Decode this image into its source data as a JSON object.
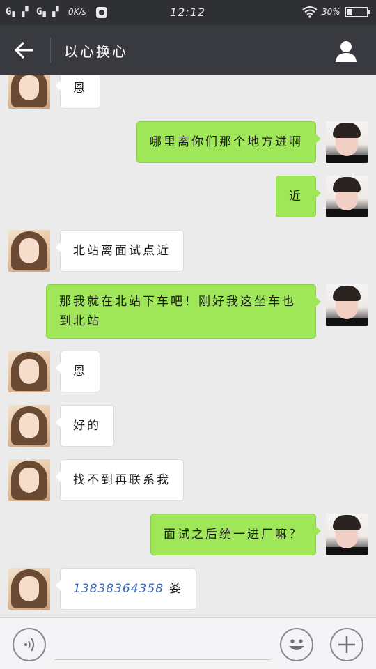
{
  "status_bar": {
    "signal_1": "G",
    "signal_2": "G",
    "net_speed": "0K/s",
    "time": "12:12",
    "battery_percent": "30%",
    "battery_level": 0.3
  },
  "header": {
    "title": "以心换心",
    "icons": {
      "back": "back-arrow-icon",
      "contact": "person-icon"
    }
  },
  "messages": [
    {
      "side": "in",
      "text": "恩"
    },
    {
      "side": "out",
      "text": "哪里离你们那个地方进啊"
    },
    {
      "side": "out",
      "text": "近"
    },
    {
      "side": "in",
      "text": "北站离面试点近"
    },
    {
      "side": "out",
      "text": "那我就在北站下车吧！刚好我这坐车也到北站"
    },
    {
      "side": "in",
      "text": "恩"
    },
    {
      "side": "in",
      "text": "好的"
    },
    {
      "side": "in",
      "text": "找不到再联系我"
    },
    {
      "side": "out",
      "text": "面试之后统一进厂嘛？"
    },
    {
      "side": "in",
      "phone": "13838364358",
      "text": "娄"
    }
  ],
  "input_bar": {
    "value": "",
    "icons": {
      "voice": "voice-icon",
      "emoji": "emoji-icon",
      "more": "plus-icon"
    }
  }
}
